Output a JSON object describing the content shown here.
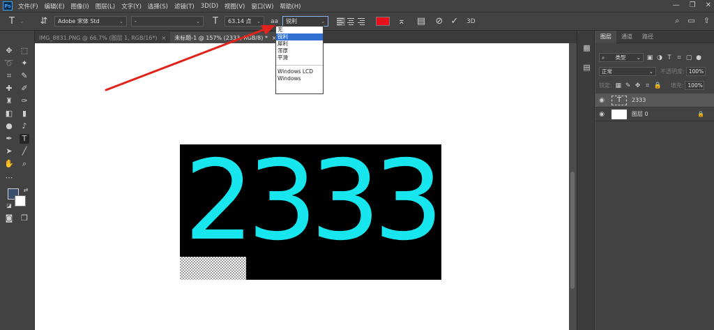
{
  "app": {
    "logo": "Ps"
  },
  "menu": [
    "文件(F)",
    "编辑(E)",
    "图像(I)",
    "图层(L)",
    "文字(Y)",
    "选择(S)",
    "滤镜(T)",
    "3D(D)",
    "视图(V)",
    "窗口(W)",
    "帮助(H)"
  ],
  "options": {
    "font_family": "Adobe 宋体 Std",
    "font_style": "-",
    "font_size": "63.14 点",
    "aa_label": "aa",
    "aa_value": "锐利",
    "threed_label": "3D"
  },
  "aa_dropdown": {
    "items": [
      "无",
      "锐利",
      "犀利",
      "浑厚",
      "平滑"
    ],
    "selected_index": 1,
    "extra_items": [
      "Windows LCD",
      "Windows"
    ]
  },
  "tabs": [
    {
      "label": "IMG_8831.PNG @ 66.7% (图层 1, RGB/16*)",
      "close": "×"
    },
    {
      "label": "未标题-1 @ 157% (2333, RGB/8) *",
      "close": "×"
    }
  ],
  "canvas": {
    "text": "2333",
    "text_color": "#17e6ef"
  },
  "colors": {
    "foreground": "#3a4e6e",
    "background": "#ffffff",
    "text_color_swatch": "#e8101a"
  },
  "layers_panel": {
    "tabs": [
      "图层",
      "通道",
      "路径"
    ],
    "filter_label": "类型",
    "blend_mode": "正常",
    "opacity_label": "不透明度:",
    "opacity_value": "100%",
    "lock_label": "锁定:",
    "fill_label": "填充:",
    "fill_value": "100%",
    "layers": [
      {
        "name": "2333",
        "thumb": "T"
      },
      {
        "name": "图层 0",
        "thumb": ""
      }
    ]
  }
}
